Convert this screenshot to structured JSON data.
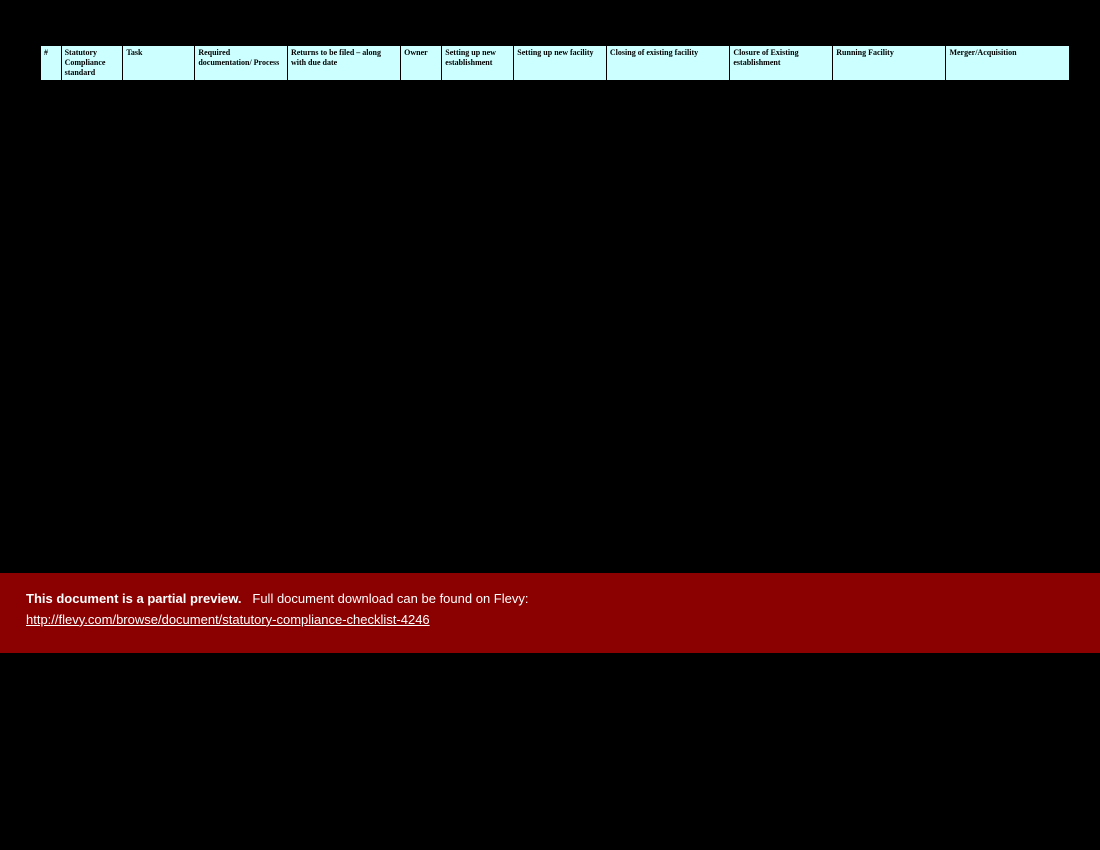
{
  "table": {
    "headers": [
      "#",
      "Statutory Compliance standard",
      "Task",
      "Required documentation/ Process",
      "Returns to be filed – along with due date",
      "Owner",
      "Setting up new establishment",
      "Setting up new facility",
      "Closing of existing facility",
      "Closure of Existing establishment",
      "Running Facility",
      "Merger/Acquisition"
    ],
    "col_widths": [
      "2%",
      "6%",
      "7%",
      "9%",
      "11%",
      "4%",
      "7%",
      "9%",
      "12%",
      "10%",
      "11%",
      "12%"
    ]
  },
  "banner": {
    "lead": "This document is a partial preview.",
    "rest": "Full document download can be found on Flevy:",
    "url_text": "http://flevy.com/browse/document/statutory-compliance-checklist-4246"
  }
}
